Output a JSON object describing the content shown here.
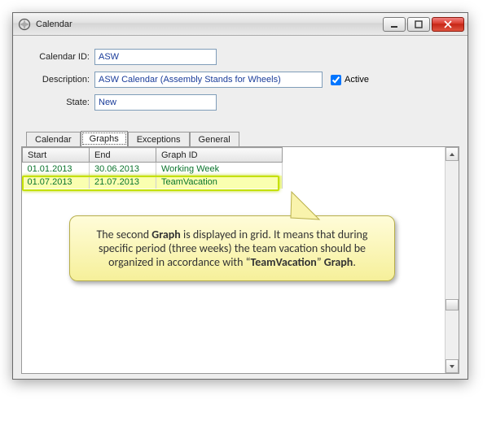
{
  "window": {
    "title": "Calendar"
  },
  "form": {
    "calendarIdLabel": "Calendar ID:",
    "calendarIdValue": "ASW",
    "descriptionLabel": "Description:",
    "descriptionValue": "ASW Calendar (Assembly Stands for Wheels)",
    "activeLabel": "Active",
    "activeChecked": true,
    "stateLabel": "State:",
    "stateValue": "New"
  },
  "tabs": {
    "items": [
      {
        "label": "Calendar"
      },
      {
        "label": "Graphs"
      },
      {
        "label": "Exceptions"
      },
      {
        "label": "General"
      }
    ],
    "activeIndex": 1
  },
  "grid": {
    "columns": [
      {
        "label": "Start"
      },
      {
        "label": "End"
      },
      {
        "label": "Graph ID"
      }
    ],
    "rows": [
      {
        "start": "01.01.2013",
        "end": "30.06.2013",
        "graphId": "Working Week",
        "highlight": false
      },
      {
        "start": "01.07.2013",
        "end": "21.07.2013",
        "graphId": "TeamVacation",
        "highlight": true
      }
    ]
  },
  "callout": {
    "pre1": "The second ",
    "b1": "Graph",
    "mid1": " is displayed in grid. It means that during specific period (three weeks) the team vacation should be organized in accordance with “",
    "b2": "TeamVacation",
    "mid2": "” ",
    "b3": "Graph",
    "post": "."
  }
}
